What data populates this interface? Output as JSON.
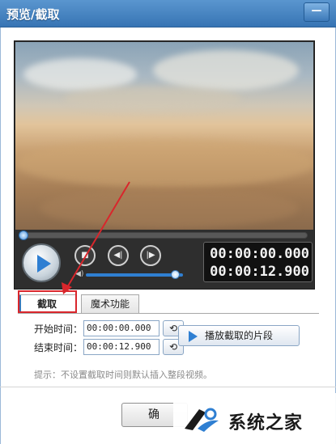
{
  "window": {
    "title": "预览/截取",
    "minimize_label": "—"
  },
  "player": {
    "current_time": "00:00:00.000",
    "total_time": "00:00:12.900",
    "seek_progress": 0,
    "volume_level": 0.92,
    "controls": {
      "stop_icon": "stop-icon",
      "prev_icon": "step-back-icon",
      "next_icon": "step-forward-icon",
      "play_icon": "play-icon",
      "volume_icon": "speaker-icon"
    }
  },
  "tabs": [
    {
      "label": "截取",
      "active": true
    },
    {
      "label": "魔术功能",
      "active": false
    }
  ],
  "cut": {
    "start_label": "开始时间：",
    "start_value": "00:00:00.000",
    "end_label": "结束时间：",
    "end_value": "00:00:12.900",
    "play_segment_label": "播放截取的片段",
    "hint": "提示：不设置截取时间则默认插入整段视频。"
  },
  "footer": {
    "ok_label": "确"
  },
  "watermark": {
    "text": "系统之家"
  },
  "colors": {
    "accent": "#2f7fd2",
    "highlight": "#d9262c",
    "titlebar": "#3774b4"
  }
}
